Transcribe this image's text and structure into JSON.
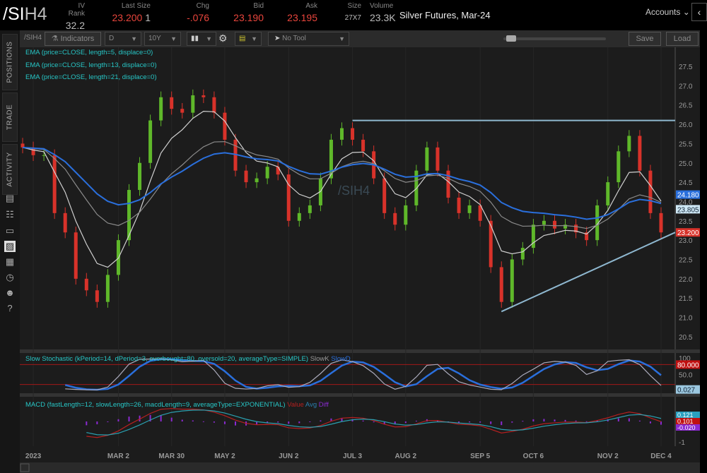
{
  "header": {
    "symbol": "/SI",
    "symbol_suffix": "H4",
    "quotes": [
      {
        "label": "IV Rank",
        "value": "32.2"
      },
      {
        "label": "Last Size",
        "value": "23.200",
        "size": "1"
      },
      {
        "label": "Chg",
        "value": "-.076"
      },
      {
        "label": "Bid",
        "value": "23.190"
      },
      {
        "label": "Ask",
        "value": "23.195"
      },
      {
        "label": "Size",
        "value": "27X7"
      },
      {
        "label": "Volume",
        "value": "23.3K"
      }
    ],
    "description": "Silver Futures, Mar-24",
    "accounts": "Accounts",
    "collapse_icon": "‹"
  },
  "toolbar": {
    "symbol": "/SIH4",
    "indicators": "Indicators",
    "aggregation": "D",
    "period": "10Y",
    "tool": "No Tool",
    "save": "Save",
    "load": "Load"
  },
  "sidebar": {
    "tabs": [
      "POSITIONS",
      "TRADE",
      "ACTIVITY"
    ]
  },
  "legend": {
    "ema": [
      "EMA (price=CLOSE, length=5, displace=0)",
      "EMA (price=CLOSE, length=13, displace=0)",
      "EMA (price=CLOSE, length=21, displace=0)"
    ],
    "watermark": "/SIH4",
    "stoch": "Slow Stochastic (kPeriod=14, dPeriod=3, overbought=80, oversold=20, averageType=SIMPLE)",
    "stoch_k": "SlowK",
    "stoch_d": "SlowD",
    "macd": "MACD (fastLength=12, slowLength=26, macdLength=9, averageType=EXPONENTIAL)",
    "macd_value": "Value",
    "macd_avg": "Avg",
    "macd_diff": "Diff"
  },
  "colors": {
    "up": "#5fb82a",
    "down": "#d8322a",
    "ema5": "#d0d0d0",
    "ema13": "#8a8a8a",
    "ema21": "#2a6fdc",
    "line": "#8fb8d0",
    "ob": "#a01818",
    "macd_val": "#b52020",
    "macd_avg": "#2aa0b0",
    "diff": "#8a2ad0"
  },
  "chart_data": {
    "type": "candlestick",
    "title": "/SIH4 Daily",
    "price_ticks": [
      "27.5",
      "27.0",
      "26.5",
      "26.0",
      "25.5",
      "25.0",
      "24.5",
      "24.0",
      "23.5",
      "23.0",
      "22.5",
      "22.0",
      "21.5",
      "21.0",
      "20.5"
    ],
    "ylim": [
      20.3,
      27.8
    ],
    "x_ticks": [
      "2023",
      "MAR 2",
      "MAR 30",
      "MAY 2",
      "JUN 2",
      "JUL 3",
      "AUG 2",
      "SEP 5",
      "OCT 6",
      "NOV 2",
      "DEC 4"
    ],
    "x_tick_index": [
      1,
      9,
      14,
      19,
      25,
      31,
      36,
      43,
      48,
      55,
      60
    ],
    "closes": [
      25.4,
      25.2,
      25.2,
      23.7,
      23.2,
      22.0,
      21.7,
      21.4,
      22.1,
      23.0,
      24.3,
      25.0,
      26.1,
      26.7,
      26.4,
      26.3,
      26.75,
      26.7,
      26.3,
      25.6,
      24.8,
      24.5,
      24.6,
      24.9,
      24.7,
      23.5,
      23.7,
      23.9,
      24.6,
      25.6,
      25.9,
      25.6,
      25.3,
      24.6,
      23.7,
      23.4,
      23.9,
      24.8,
      25.4,
      24.8,
      24.1,
      23.7,
      23.9,
      23.5,
      22.3,
      21.4,
      22.5,
      22.8,
      23.4,
      23.5,
      23.3,
      23.4,
      23.2,
      23.0,
      23.9,
      24.5,
      25.3,
      25.7,
      24.8,
      23.7,
      23.2
    ],
    "resistance": 26.1,
    "resistance_start_index": 31,
    "trendline": {
      "start_index": 45,
      "start": 21.15,
      "end": 23.2
    },
    "price_labels": [
      {
        "value": "24.180",
        "color": "#2a6fdc"
      },
      {
        "value": "23.805",
        "color": "#cfe8f5"
      },
      {
        "value": "23.200",
        "color": "#d8322a"
      }
    ],
    "stoch": {
      "ticks": [
        "100",
        "50.0"
      ],
      "overbought": 80,
      "oversold": 20,
      "labels": [
        {
          "value": "80.000",
          "color": "#c01010"
        },
        {
          "value": "0.027",
          "color": "#9cc8e0"
        }
      ]
    },
    "macd": {
      "ticks": [
        "-1"
      ],
      "labels": [
        {
          "value": "0.121",
          "color": "#2aa0c0"
        },
        {
          "value": "0.101",
          "color": "#c01010"
        },
        {
          "value": "-0.020",
          "color": "#8a2ad0"
        }
      ]
    }
  }
}
